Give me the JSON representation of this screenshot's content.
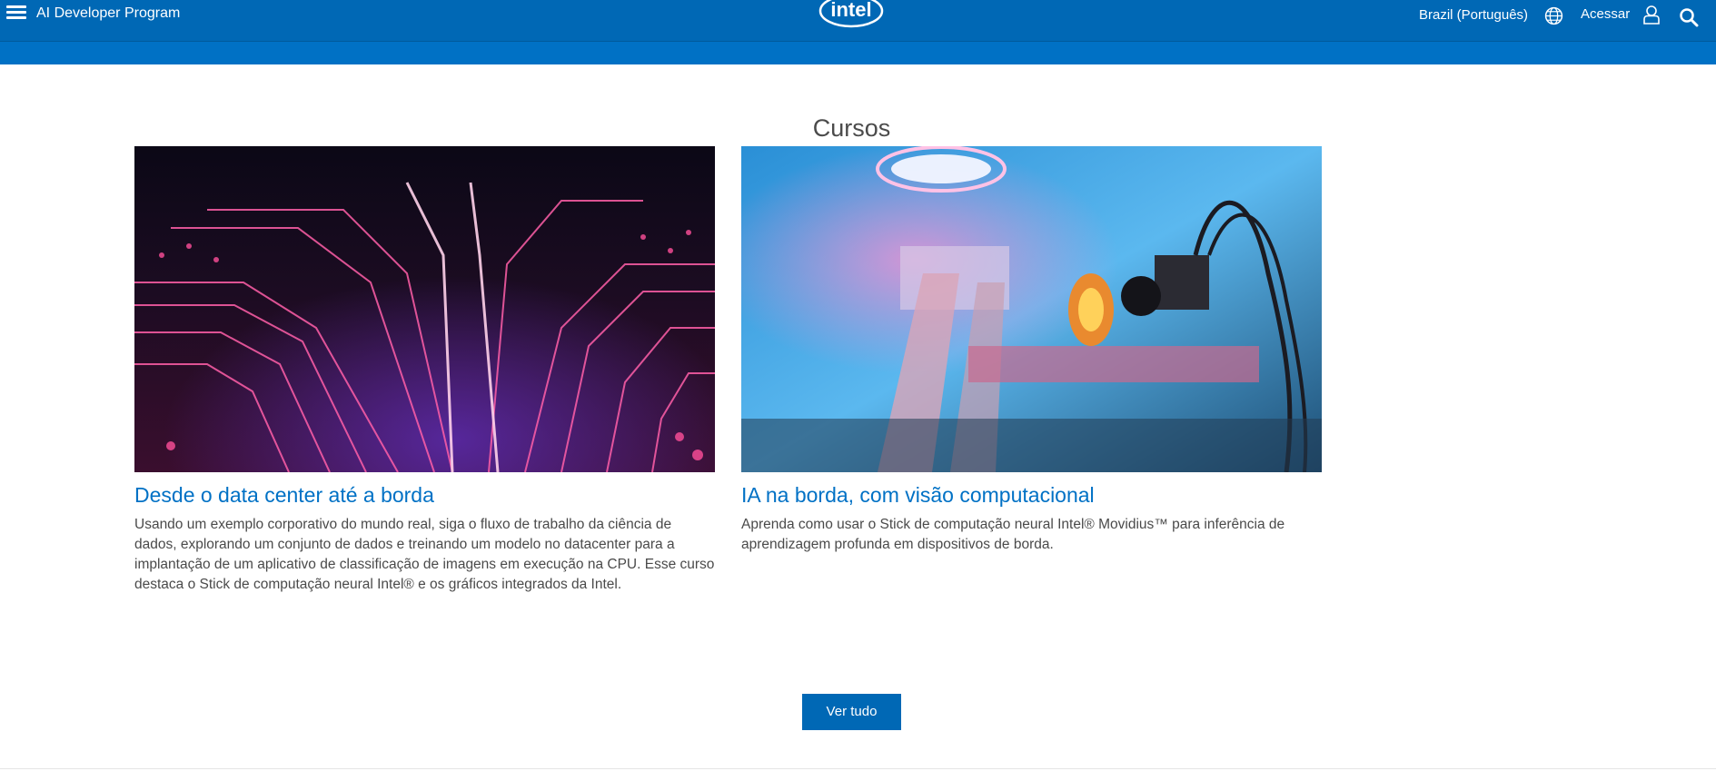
{
  "header": {
    "brand": "AI Developer Program",
    "logo_text": "intel",
    "region": "Brazil (Português)",
    "login": "Acessar"
  },
  "main": {
    "section_title": "Cursos",
    "cards": [
      {
        "title": "Desde o data center até a borda",
        "description": "Usando um exemplo corporativo do mundo real, siga o fluxo de trabalho da ciência de dados, explorando um conjunto de dados e treinando um modelo no datacenter para a implantação de um aplicativo de classificação de imagens em execução na CPU. Esse curso destaca o Stick de computação neural Intel® e os gráficos integrados da Intel."
      },
      {
        "title": "IA na borda, com visão computacional",
        "description": "Aprenda como usar o Stick de computação neural Intel® Movidius™ para inferência de aprendizagem profunda em dispositivos de borda."
      }
    ],
    "view_all": "Ver tudo"
  },
  "colors": {
    "brand_blue": "#0068b5",
    "link_blue": "#0071c5"
  },
  "icons": [
    "hamburger-menu-icon",
    "globe-icon",
    "user-icon",
    "search-icon"
  ]
}
